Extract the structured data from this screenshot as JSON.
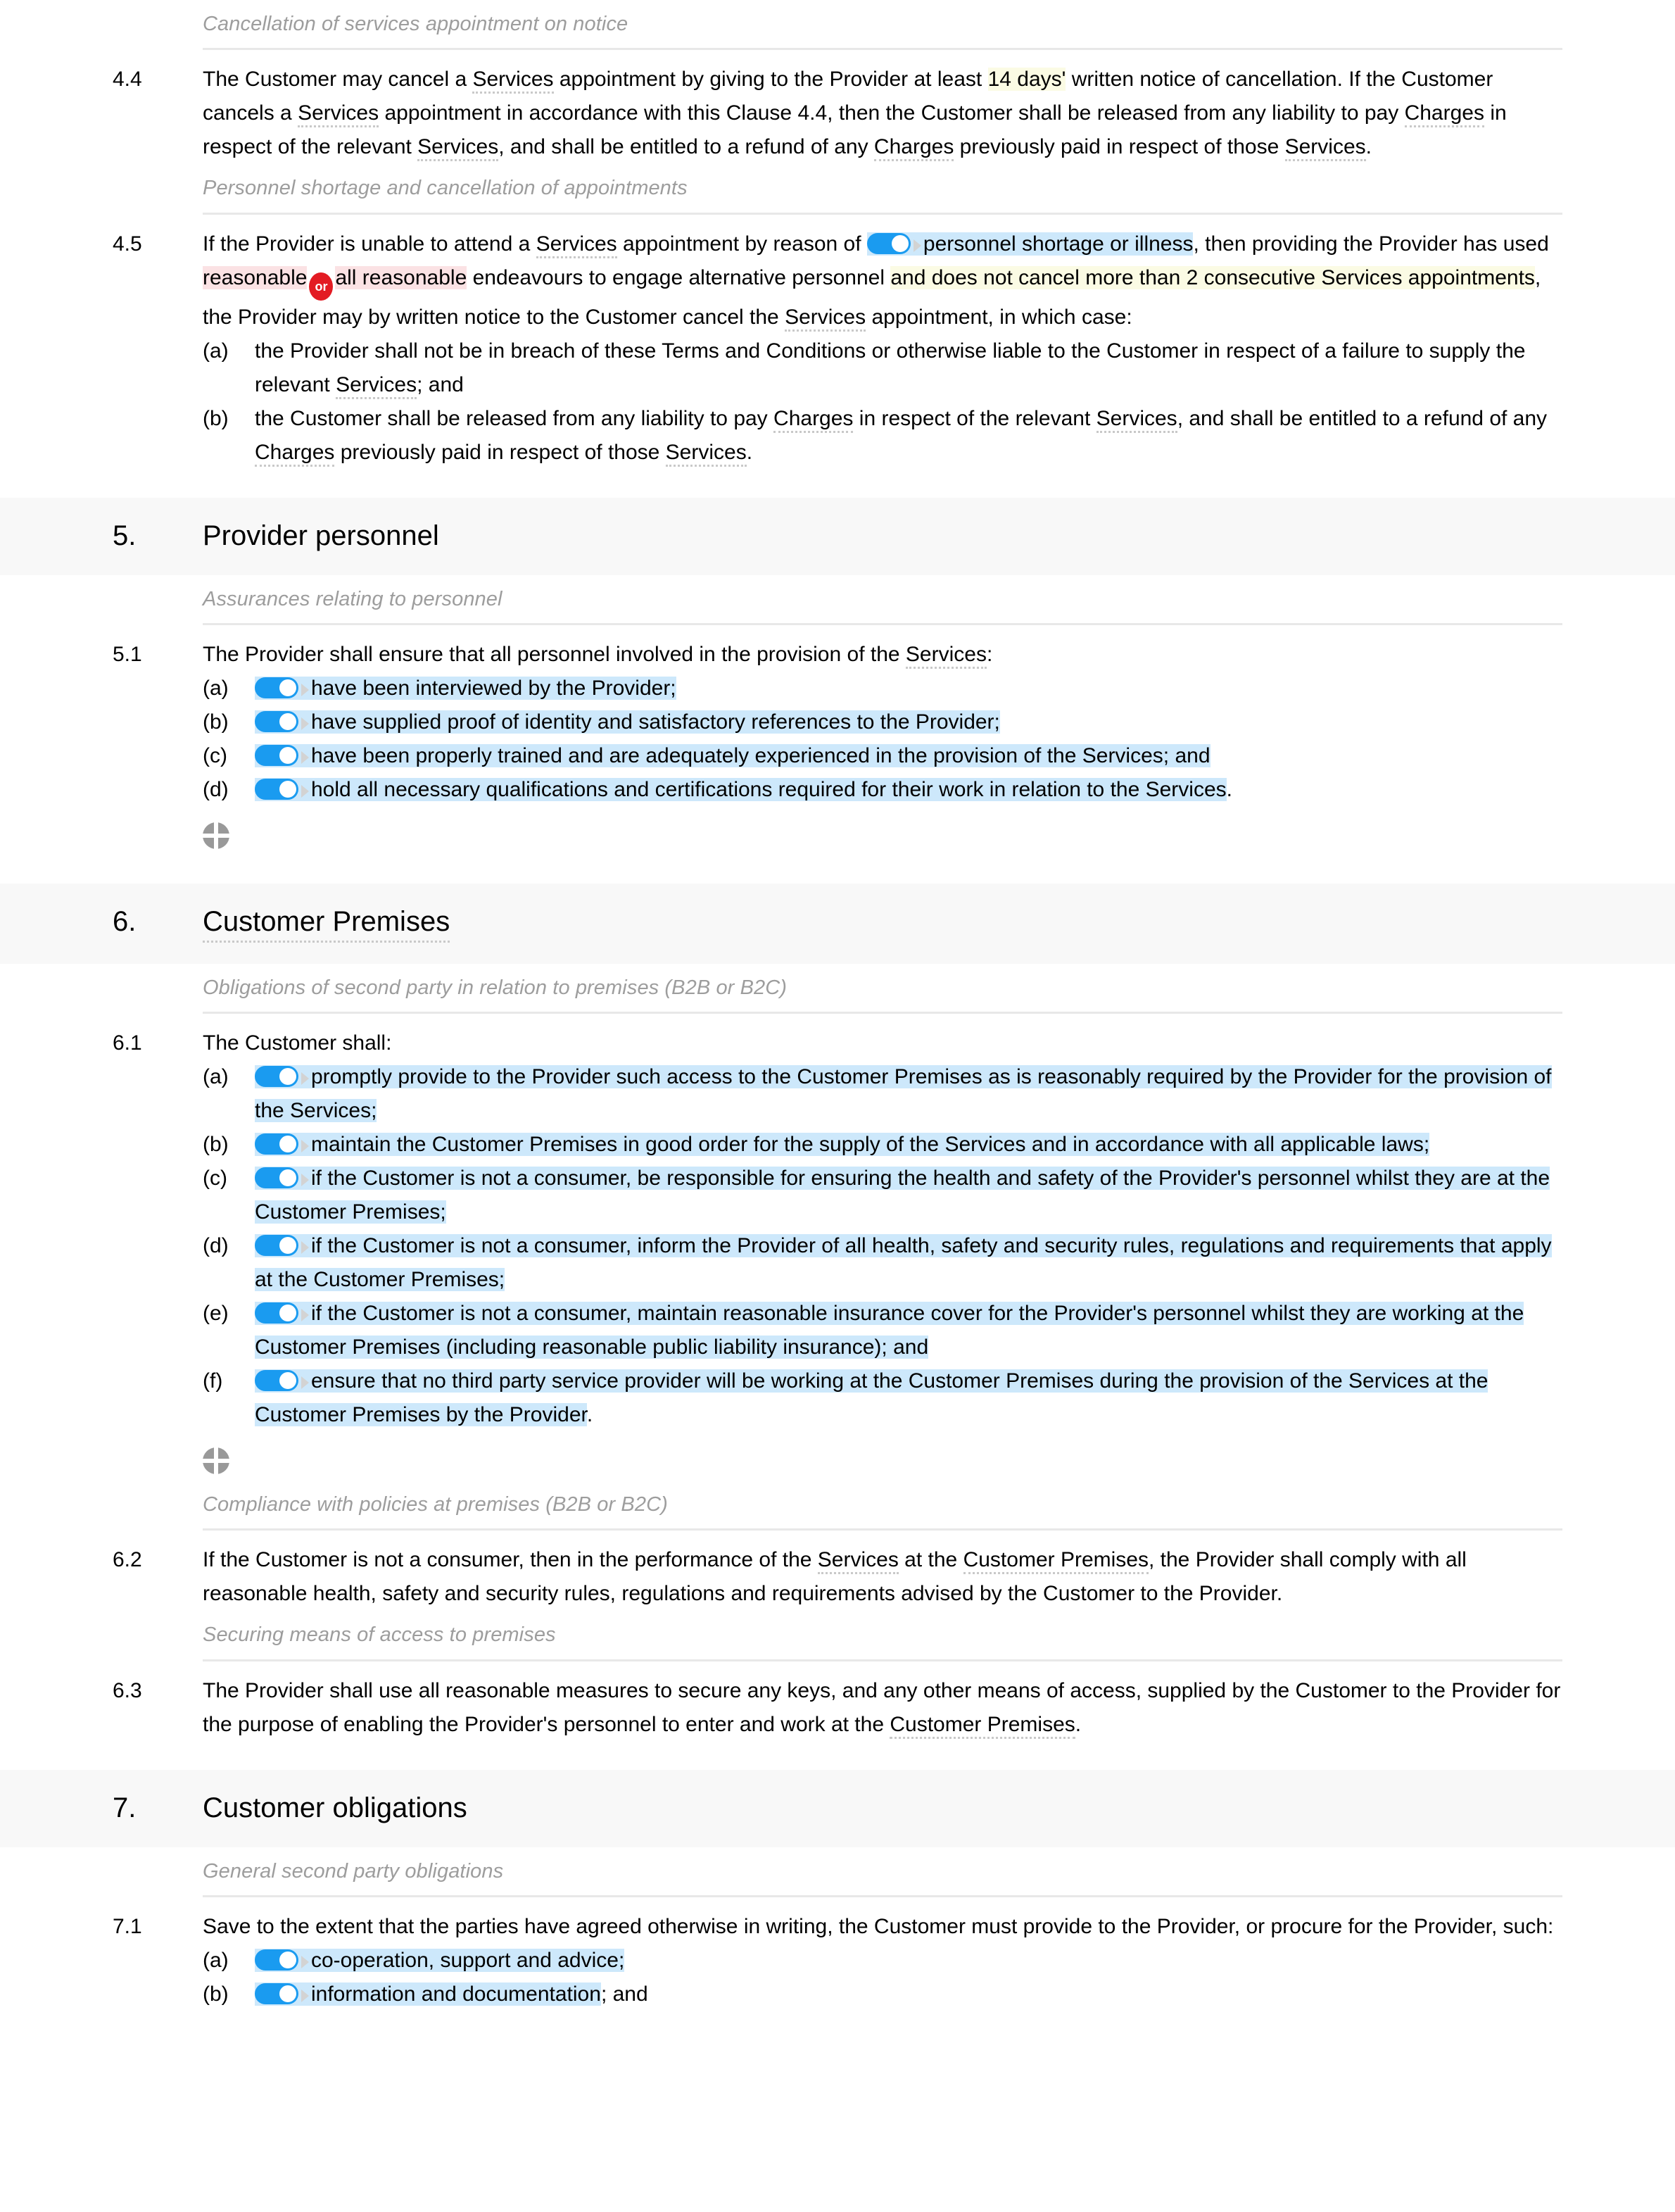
{
  "colors": {
    "toggle_on": "#1a9bf0",
    "highlight_blue": "#cde8fb",
    "highlight_yellow": "#fbfbe4",
    "highlight_pink": "#fbe2e4",
    "or_badge": "#e31b23",
    "section_band": "#f8f8f8",
    "subheading_text": "#9d9d9d"
  },
  "icons": {
    "toggle": "toggle-switch-on",
    "or_badge_label": "or",
    "insert_marker": "crosshair-circle-insert"
  },
  "s44": {
    "subheading": "Cancellation of services appointment on notice",
    "number": "4.4",
    "t1": "The Customer may cancel a ",
    "term_services_1": "Services",
    "t2": " appointment by giving to the Provider at least ",
    "var_days": "14 days'",
    "t3": " written notice of cancellation. If the Customer cancels a ",
    "term_services_2": "Services",
    "t4": " appointment in accordance with this Clause 4.4, then the Customer shall be released from any liability to pay ",
    "term_charges_1": "Charges",
    "t5": " in respect of the relevant ",
    "term_services_3": "Services",
    "t6": ", and shall be entitled to a refund of any ",
    "term_charges_2": "Charges",
    "t7": " previously paid in respect of those ",
    "term_services_4": "Services",
    "t8": "."
  },
  "s45": {
    "subheading": "Personnel shortage and cancellation of appointments",
    "number": "4.5",
    "t1": "If the Provider is unable to attend a ",
    "term_services_1": "Services",
    "t2": " appointment by reason of ",
    "opt_personnel": "personnel shortage or illness",
    "t3": ", then providing the Provider has used ",
    "alt_a": "reasonable",
    "alt_b": "all reasonable",
    "t4": " endeavours to engage alternative personnel ",
    "var_clause": "and does not cancel more than 2 consecutive Services appointments",
    "t5": ", the Provider may by written notice to the Customer cancel the ",
    "term_services_2": "Services",
    "t6": " appointment, in which case:",
    "items": [
      {
        "marker": "(a)",
        "t1": "the Provider shall not be in breach of these Terms and Conditions or otherwise liable to the Customer in respect of a failure to supply the relevant ",
        "term": "Services",
        "t2": "; and"
      },
      {
        "marker": "(b)",
        "t1": "the Customer shall be released from any liability to pay ",
        "term1": "Charges",
        "t2": " in respect of the relevant ",
        "term2": "Services",
        "t3": ", and shall be entitled to a refund of any ",
        "term3": "Charges",
        "t4": " previously paid in respect of those ",
        "term4": "Services",
        "t5": "."
      }
    ]
  },
  "section5": {
    "number": "5.",
    "title": "Provider personnel"
  },
  "s51": {
    "subheading": "Assurances relating to personnel",
    "number": "5.1",
    "lead_t1": "The Provider shall ensure that all personnel involved in the provision of the ",
    "lead_term": "Services",
    "lead_t2": ":",
    "items": [
      {
        "marker": "(a)",
        "opt": "have been interviewed by the Provider;",
        "tail": ""
      },
      {
        "marker": "(b)",
        "opt": "have supplied proof of identity and satisfactory references to the Provider;",
        "tail": ""
      },
      {
        "marker": "(c)",
        "opt": "have been properly trained and are adequately experienced in the provision of the Services; and",
        "tail": ""
      },
      {
        "marker": "(d)",
        "opt": "hold all necessary qualifications and certifications required for their work in relation to the Services",
        "tail": "."
      }
    ]
  },
  "section6": {
    "number": "6.",
    "title": "Customer Premises"
  },
  "s61": {
    "subheading": "Obligations of second party in relation to premises (B2B or B2C)",
    "number": "6.1",
    "lead": "The Customer shall:",
    "items": [
      {
        "marker": "(a)",
        "opt": "promptly provide to the Provider such access to the Customer Premises as is reasonably required by the Provider for the provision of the Services;",
        "tail": ""
      },
      {
        "marker": "(b)",
        "opt": "maintain the Customer Premises in good order for the supply of the Services and in accordance with all applicable laws;",
        "tail": ""
      },
      {
        "marker": "(c)",
        "opt": "if the Customer is not a consumer, be responsible for ensuring the health and safety of the Provider's personnel whilst they are at the Customer Premises;",
        "tail": ""
      },
      {
        "marker": "(d)",
        "opt": "if the Customer is not a consumer, inform the Provider of all health, safety and security rules, regulations and requirements that apply at the Customer Premises;",
        "tail": ""
      },
      {
        "marker": "(e)",
        "opt": "if the Customer is not a consumer, maintain reasonable insurance cover for the Provider's personnel whilst they are working at the Customer Premises (including reasonable public liability insurance); and",
        "tail": ""
      },
      {
        "marker": "(f)",
        "opt": "ensure that no third party service provider will be working at the Customer Premises during the provision of the Services at the Customer Premises by the Provider",
        "tail": "."
      }
    ]
  },
  "s62": {
    "subheading": "Compliance with policies at premises (B2B or B2C)",
    "number": "6.2",
    "t1": "If the Customer is not a consumer, then in the performance of the ",
    "term1": "Services",
    "t2": " at the ",
    "term2": "Customer Premises",
    "t3": ", the Provider shall comply with all reasonable health, safety and security rules, regulations and requirements advised by the Customer to the Provider."
  },
  "s63": {
    "subheading": "Securing means of access to premises",
    "number": "6.3",
    "t1": "The Provider shall use all reasonable measures to secure any keys, and any other means of access, supplied by the Customer to the Provider for the purpose of enabling the Provider's personnel to enter and work at the ",
    "term1": "Customer Premises",
    "t2": "."
  },
  "section7": {
    "number": "7.",
    "title": "Customer obligations"
  },
  "s71": {
    "subheading": "General second party obligations",
    "number": "7.1",
    "lead": "Save to the extent that the parties have agreed otherwise in writing, the Customer must provide to the Provider, or procure for the Provider, such:",
    "items": [
      {
        "marker": "(a)",
        "opt": "co-operation, support and advice;",
        "tail": ""
      },
      {
        "marker": "(b)",
        "opt": "information and documentation",
        "tail": "; and"
      }
    ]
  }
}
